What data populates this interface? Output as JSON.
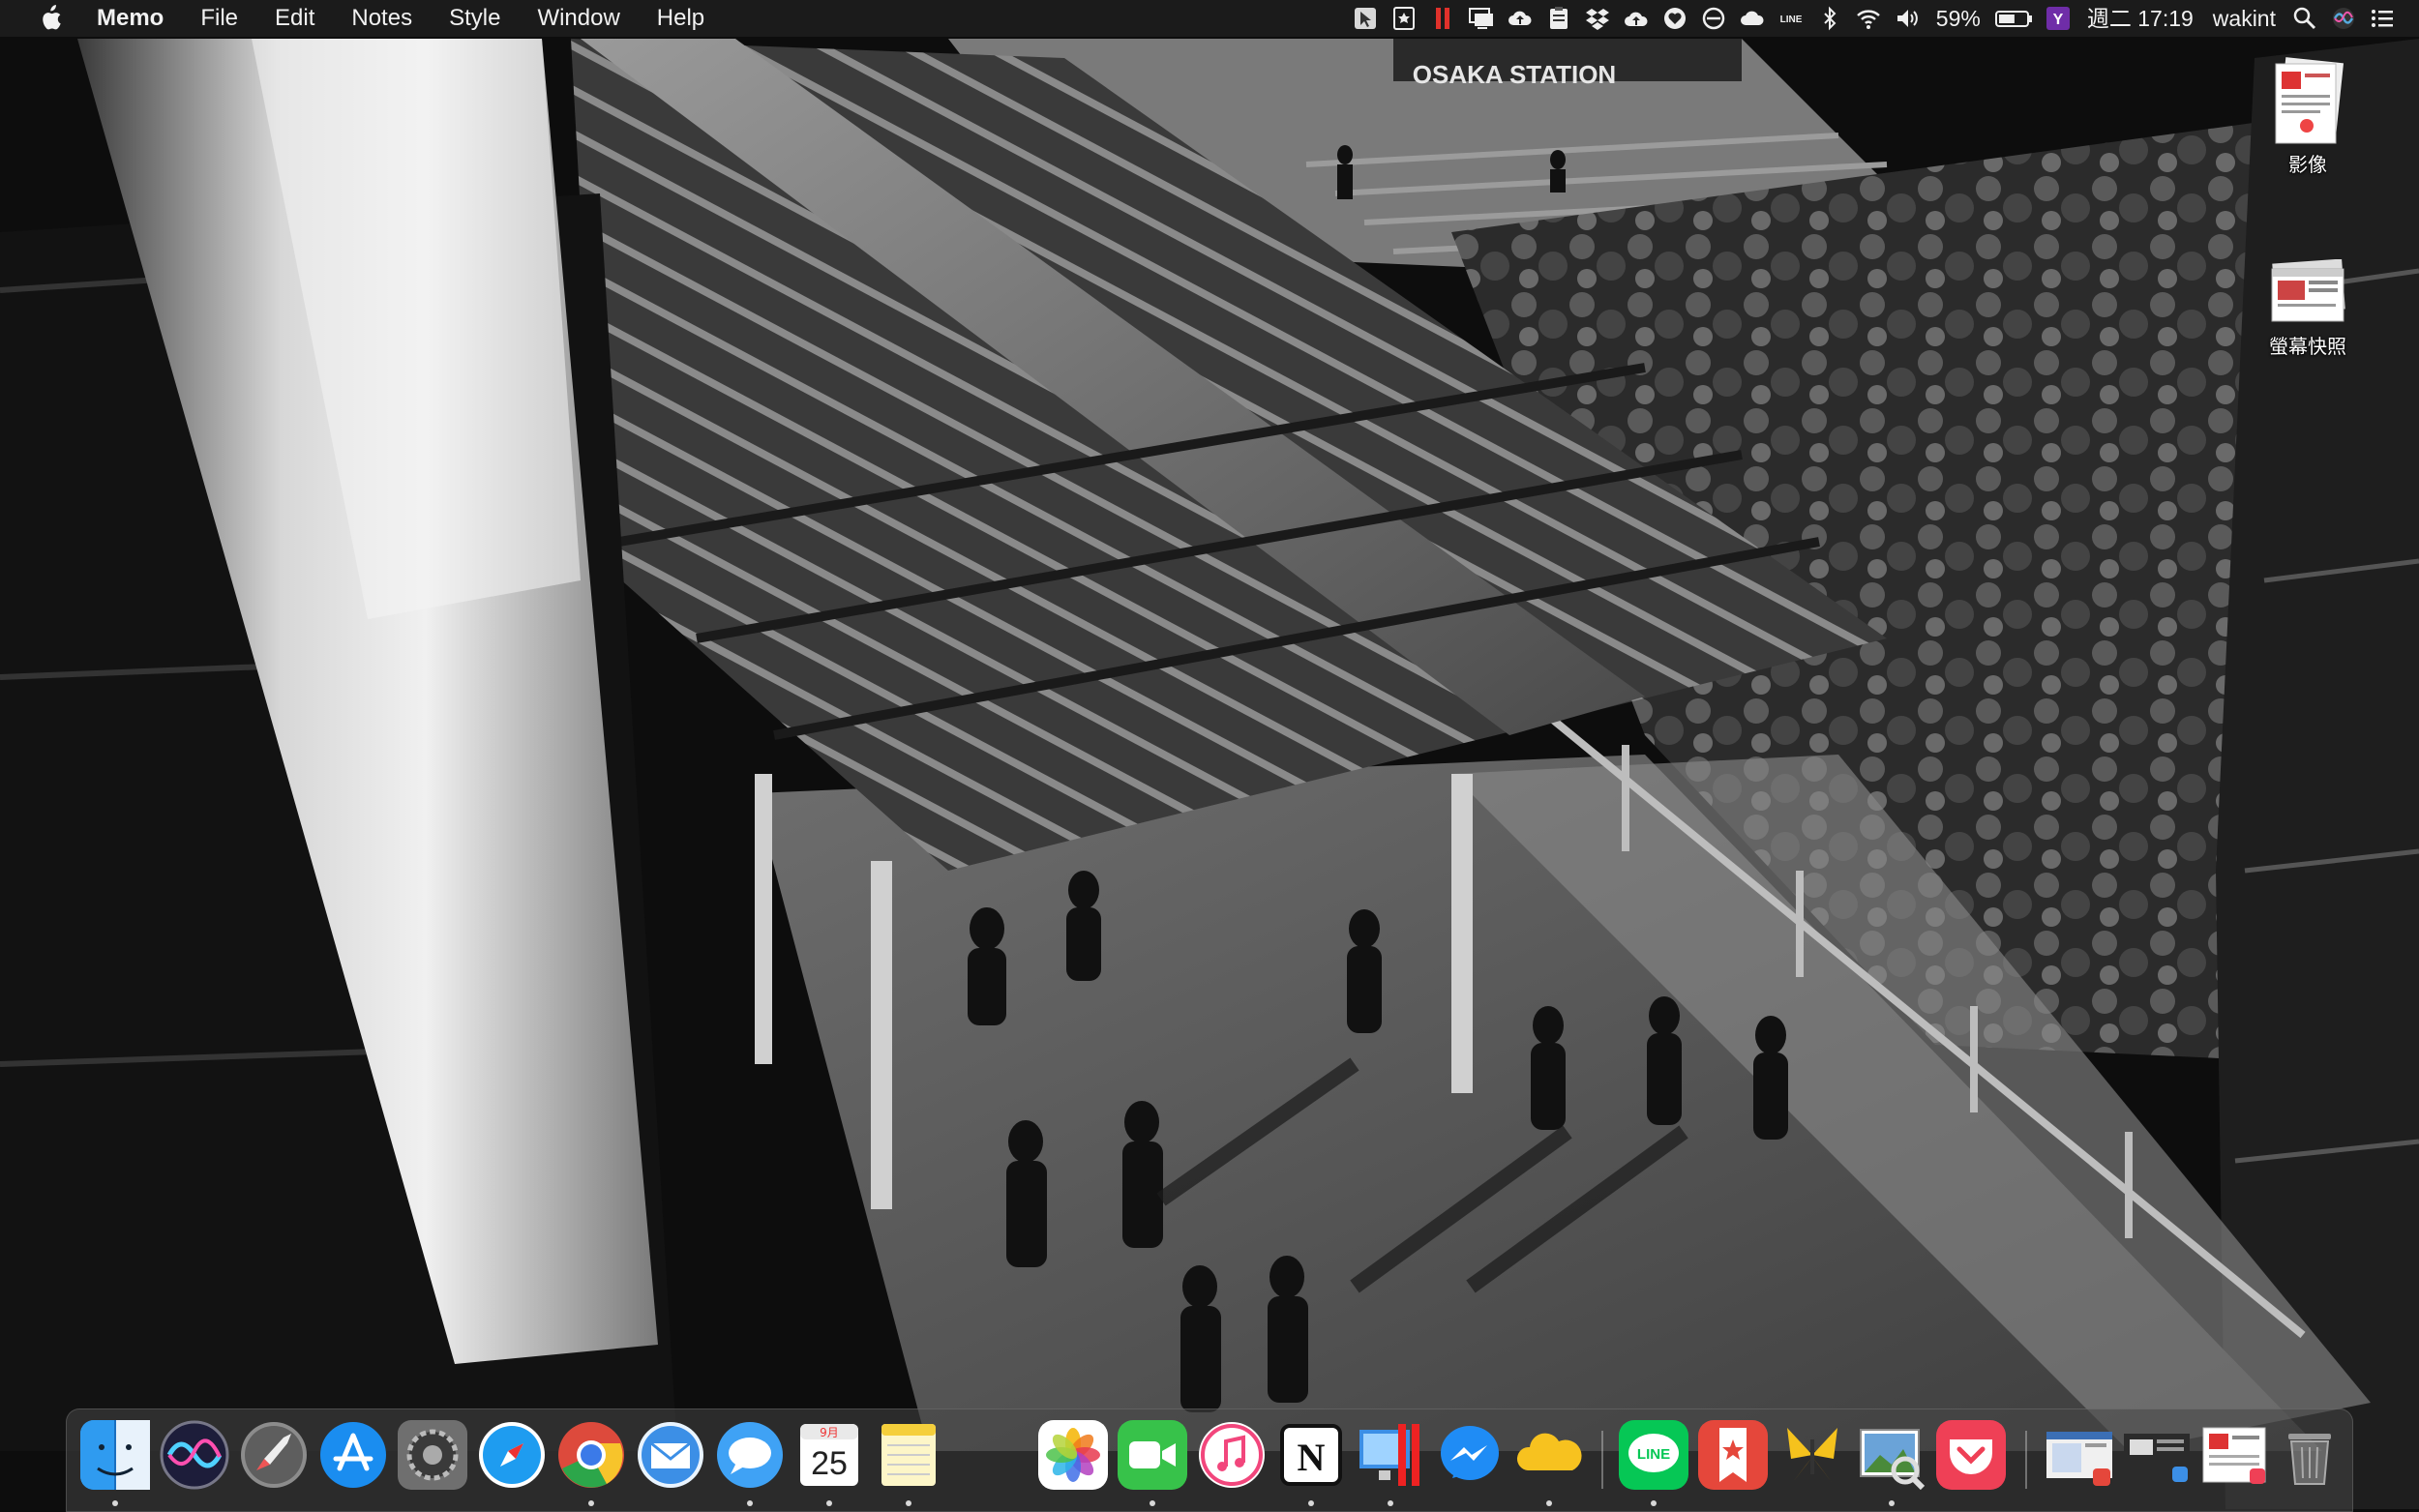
{
  "menubar": {
    "apple_icon": "apple-logo-icon",
    "app_name": "Memo",
    "menus": [
      "File",
      "Edit",
      "Notes",
      "Style",
      "Window",
      "Help"
    ],
    "battery_percent": "59%",
    "battery_level": 0.59,
    "clock": "週二 17:19",
    "user": "wakint",
    "status_icons": [
      "cursor-icon",
      "bookmark-icon",
      "pause-icon",
      "display-icon",
      "cloud-upload-icon",
      "clipboard-icon",
      "dropbox-icon",
      "cloud-sync-icon",
      "heart-icon",
      "circle-icon",
      "icloud-icon",
      "line-icon",
      "bluetooth-icon",
      "wifi-icon",
      "volume-icon",
      "battery-icon",
      "yahoo-icon",
      "spotlight-icon",
      "siri-icon",
      "control-list-icon"
    ]
  },
  "wallpaper": {
    "sign_text": "OSAKA STATION"
  },
  "desktop_icons": [
    {
      "label": "影像"
    },
    {
      "label": "螢幕快照"
    }
  ],
  "dock": {
    "calendar_month": "9月",
    "calendar_day": "25",
    "apps": [
      "finder",
      "siri",
      "launchpad",
      "app-store",
      "system-preferences",
      "safari",
      "chrome",
      "mail",
      "messages",
      "calendar",
      "notes",
      "photos",
      "facetime",
      "itunes",
      "notion",
      "screen-sharing",
      "messenger",
      "cloud-drive",
      "line",
      "wunderlist",
      "tes",
      "preview",
      "pocket",
      "window-1",
      "window-2",
      "window-3",
      "trash"
    ]
  }
}
